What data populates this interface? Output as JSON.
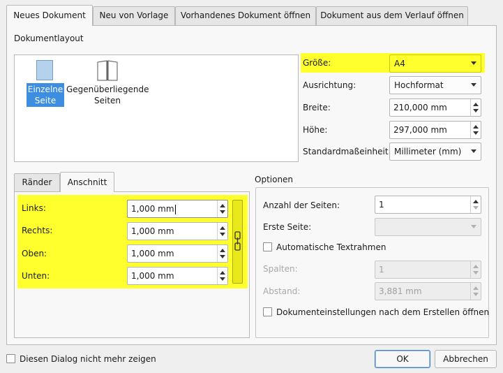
{
  "tabs": [
    {
      "label": "Neues Dokument",
      "active": true
    },
    {
      "label": "Neu von Vorlage",
      "active": false
    },
    {
      "label": "Vorhandenes Dokument öffnen",
      "active": false
    },
    {
      "label": "Dokument aus dem Verlauf öffnen",
      "active": false
    }
  ],
  "layout": {
    "group_title": "Dokumentlayout",
    "single_page": {
      "line1": "Einzelne",
      "line2": "Seite",
      "selected": true
    },
    "facing_pages": {
      "line1": "Gegenüberliegende",
      "line2": "Seiten",
      "selected": false
    }
  },
  "page_settings": {
    "size_label": "Größe:",
    "size_value": "A4",
    "orientation_label": "Ausrichtung:",
    "orientation_value": "Hochformat",
    "width_label": "Breite:",
    "width_value": "210,000 mm",
    "height_label": "Höhe:",
    "height_value": "297,000 mm",
    "unit_label": "Standardmaßeinheit:",
    "unit_value": "Millimeter (mm)"
  },
  "margin_tabs": [
    {
      "label": "Ränder",
      "active": false
    },
    {
      "label": "Anschnitt",
      "active": true
    }
  ],
  "bleed": {
    "left_label": "Links:",
    "left_value": "1,000 mm",
    "right_label": "Rechts:",
    "right_value": "1,000 mm",
    "top_label": "Oben:",
    "top_value": "1,000 mm",
    "bottom_label": "Unten:",
    "bottom_value": "1,000 mm",
    "link_icon": "chain-link-icon"
  },
  "options": {
    "group_title": "Optionen",
    "pages_label": "Anzahl der Seiten:",
    "pages_value": "1",
    "first_page_label": "Erste Seite:",
    "first_page_value": "",
    "auto_frames_label": "Automatische Textrahmen",
    "auto_frames_checked": false,
    "columns_label": "Spalten:",
    "columns_value": "1",
    "gap_label": "Abstand:",
    "gap_value": "3,881 mm",
    "open_settings_label": "Dokumenteinstellungen nach dem Erstellen öffnen",
    "open_settings_checked": false
  },
  "footer": {
    "dont_show_label": "Diesen Dialog nicht mehr zeigen",
    "ok_label": "OK",
    "cancel_label": "Abbrechen"
  },
  "colors": {
    "highlight": "#ffff2e",
    "selection": "#3d8ee0",
    "accent": "#3c7fc6"
  }
}
